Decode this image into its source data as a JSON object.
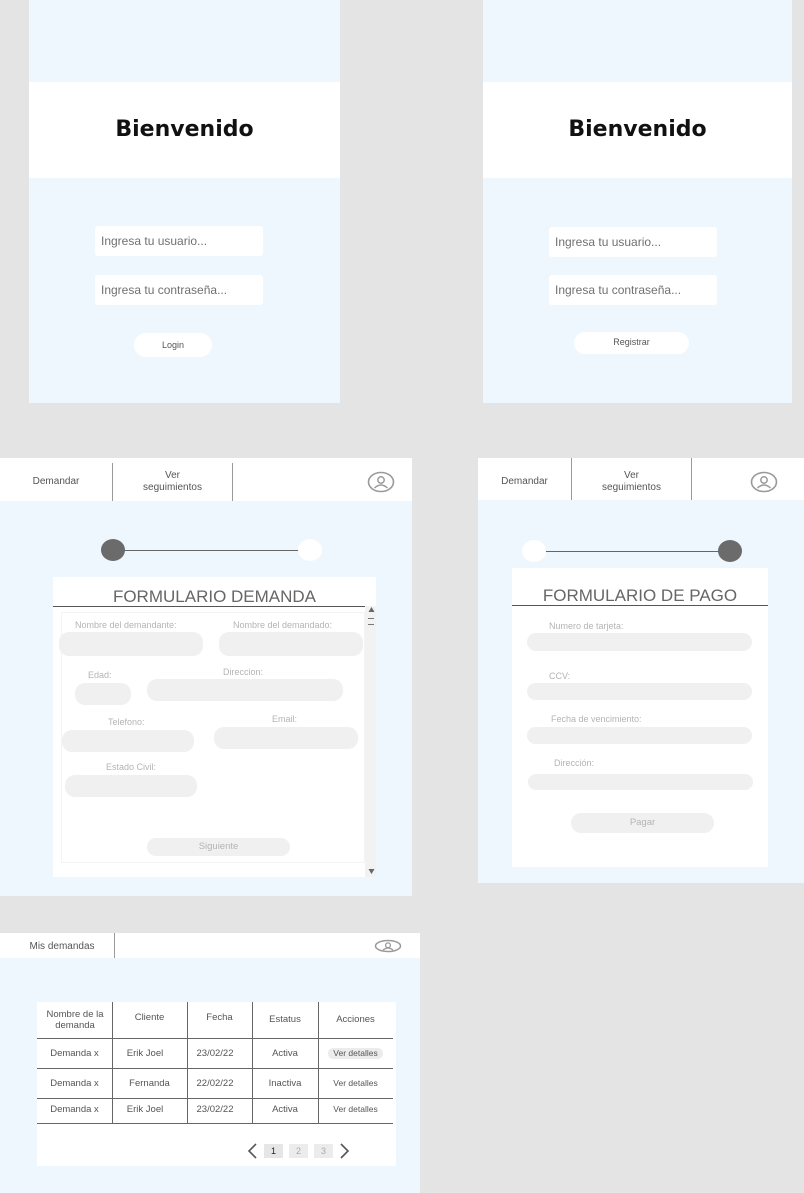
{
  "login": {
    "title": "Bienvenido",
    "user_placeholder": "Ingresa tu usuario...",
    "pass_placeholder": "Ingresa tu contraseña...",
    "button": "Login"
  },
  "register": {
    "title": "Bienvenido",
    "user_placeholder": "Ingresa tu usuario...",
    "pass_placeholder": "Ingresa tu contraseña...",
    "button": "Registrar"
  },
  "nav": {
    "demandar": "Demandar",
    "ver_seguimientos_1": "Ver",
    "ver_seguimientos_2": "seguimientos",
    "mis_demandas": "Mis demandas"
  },
  "form_demanda": {
    "title": "FORMULARIO DEMANDA",
    "fields": {
      "demandante": "Nombre del demandante:",
      "demandado": "Nombre del demandado:",
      "edad": "Edad:",
      "direccion": "Direccion:",
      "telefono": "Telefono:",
      "email": "Email:",
      "estado_civil": "Estado Civil:"
    },
    "button": "Siguiente"
  },
  "form_pago": {
    "title": "FORMULARIO DE PAGO",
    "fields": {
      "tarjeta": "Numero de tarjeta:",
      "ccv": "CCV:",
      "vencimiento": "Fecha de vencimiento:",
      "direccion": "Dirección:"
    },
    "button": "Pagar"
  },
  "table": {
    "headers": [
      "Nombre de la demanda",
      "Cliente",
      "Fecha",
      "Estatus",
      "Acciones"
    ],
    "rows": [
      [
        "Demanda x",
        "Erik Joel",
        "23/02/22",
        "Activa",
        "Ver detalles"
      ],
      [
        "Demanda x",
        "Fernanda",
        "22/02/22",
        "Inactiva",
        "Ver detalles"
      ],
      [
        "Demanda x",
        "Erik Joel",
        "23/02/22",
        "Activa",
        "Ver detalles"
      ]
    ],
    "pages": [
      "1",
      "2",
      "3"
    ]
  }
}
